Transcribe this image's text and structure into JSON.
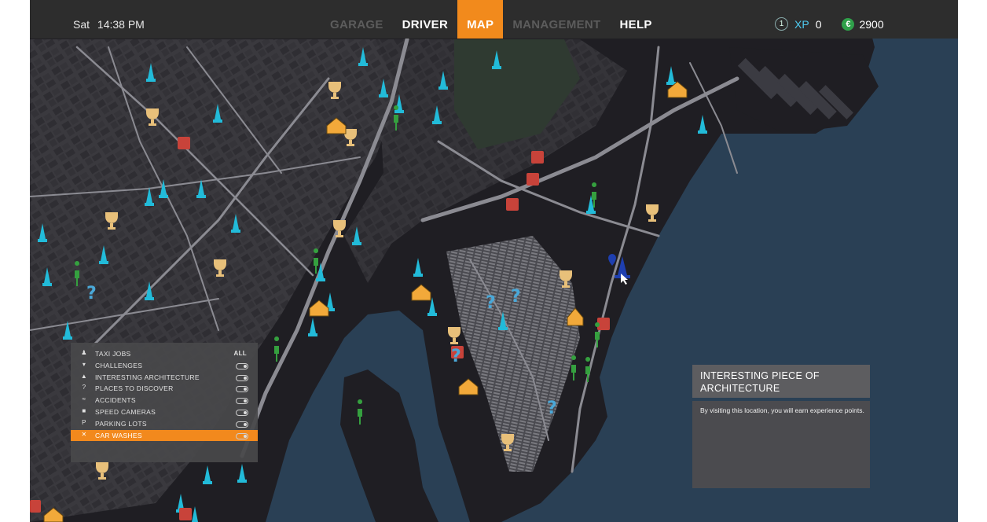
{
  "header": {
    "day": "Sat",
    "time": "14:38 PM",
    "tabs": [
      {
        "label": "GARAGE",
        "state": "disabled"
      },
      {
        "label": "DRIVER",
        "state": "normal"
      },
      {
        "label": "MAP",
        "state": "active"
      },
      {
        "label": "MANAGEMENT",
        "state": "disabled"
      },
      {
        "label": "HELP",
        "state": "normal"
      }
    ],
    "level": "1",
    "xp_label": "XP",
    "xp_value": "0",
    "currency_symbol": "€",
    "money": "2900"
  },
  "filter_panel": {
    "all_label": "ALL",
    "items": [
      {
        "label": "TAXI JOBS",
        "icon": "person-icon",
        "selected": false
      },
      {
        "label": "CHALLENGES",
        "icon": "trophy-icon",
        "selected": false
      },
      {
        "label": "INTERESTING ARCHITECTURE",
        "icon": "monument-icon",
        "selected": false
      },
      {
        "label": "PLACES TO DISCOVER",
        "icon": "question-icon",
        "selected": false
      },
      {
        "label": "ACCIDENTS",
        "icon": "accident-icon",
        "selected": false
      },
      {
        "label": "SPEED CAMERAS",
        "icon": "camera-icon",
        "selected": false
      },
      {
        "label": "PARKING LOTS",
        "icon": "parking-icon",
        "selected": false
      },
      {
        "label": "CAR WASHES",
        "icon": "car-wash-icon",
        "selected": true
      }
    ]
  },
  "info_panel": {
    "title": "INTERESTING PIECE OF ARCHITECTURE",
    "description": "By visiting this location, you will earn experience points."
  },
  "colors": {
    "accent": "#f28a1c",
    "water": "#2a4055",
    "land": "#1e1d22",
    "architecture": "#20b8d6",
    "trophy": "#e8c07a",
    "speed_camera": "#c8433a",
    "passenger": "#35a03f",
    "discover": "#4aa8d8",
    "player": "#1e3fb0"
  },
  "map_markers": [
    {
      "type": "architecture",
      "icon": "monument-icon"
    },
    {
      "type": "trophy",
      "icon": "trophy-icon"
    },
    {
      "type": "speed-camera",
      "icon": "camera-icon"
    },
    {
      "type": "passenger",
      "icon": "person-icon"
    },
    {
      "type": "discover",
      "icon": "question-icon"
    },
    {
      "type": "car-wash",
      "icon": "car-wash-icon"
    },
    {
      "type": "player",
      "icon": "player-marker-icon"
    }
  ]
}
